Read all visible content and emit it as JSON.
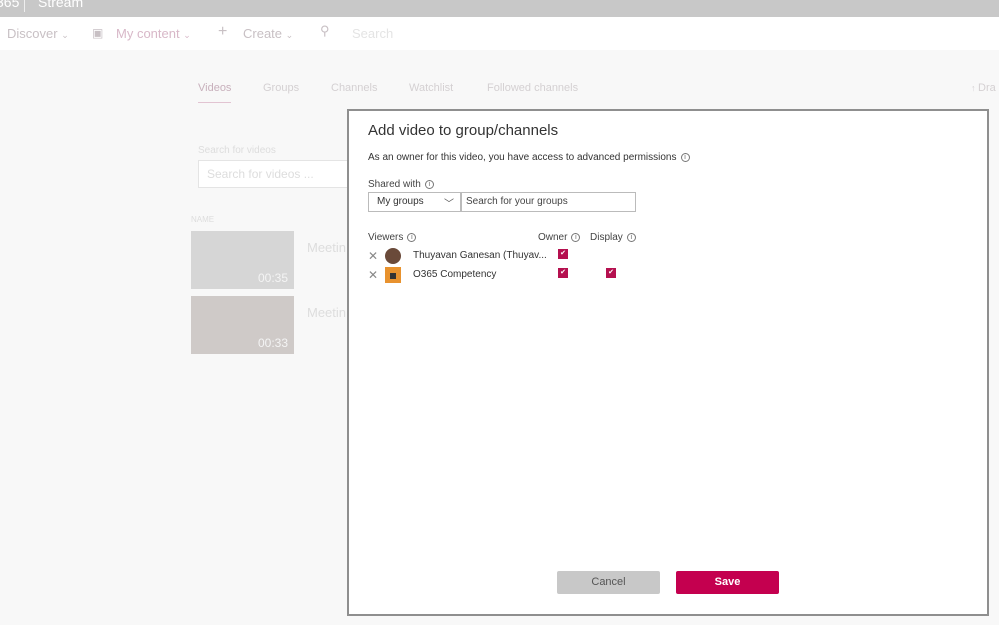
{
  "topbar": {
    "app": "365",
    "brand": "Stream"
  },
  "nav": {
    "discover": "Discover",
    "my_content": "My content",
    "create": "Create",
    "search_placeholder": "Search"
  },
  "tabs": [
    "Videos",
    "Groups",
    "Channels",
    "Watchlist",
    "Followed channels"
  ],
  "right_action": "Dra",
  "background": {
    "search_label": "Search for videos",
    "search_placeholder": "Search for videos ...",
    "column_name": "NAME",
    "videos": [
      {
        "title": "Meetin",
        "duration": "00:35"
      },
      {
        "title": "Meetin",
        "duration": "00:33"
      }
    ]
  },
  "dialog": {
    "title": "Add video to group/channels",
    "description": "As an owner for this video, you have access to advanced permissions",
    "shared_with_label": "Shared with",
    "shared_with_value": "My groups",
    "group_search_placeholder": "Search for your groups",
    "viewers_label": "Viewers",
    "owner_label": "Owner",
    "display_label": "Display",
    "viewers": [
      {
        "name": "Thuyavan Ganesan (Thuyav...",
        "type": "user",
        "owner": true,
        "display": null
      },
      {
        "name": "O365 Competency",
        "type": "group",
        "owner": true,
        "display": true
      }
    ],
    "cancel_label": "Cancel",
    "save_label": "Save"
  },
  "colors": {
    "accent": "#c4004f",
    "checkbox": "#b5104f"
  }
}
